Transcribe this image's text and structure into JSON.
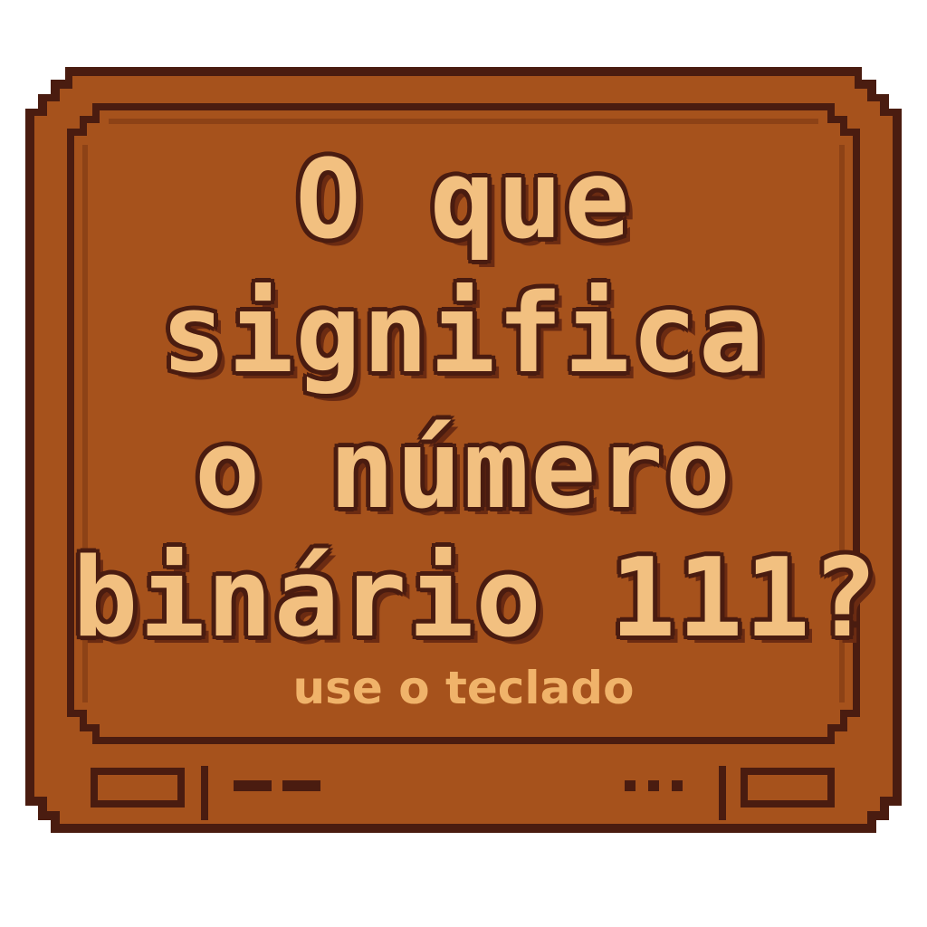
{
  "screen": {
    "question_lines": [
      "O que",
      "significa",
      "o número",
      "binário 111?"
    ],
    "hint": "use o teclado"
  },
  "colors": {
    "panel": "#a6521c",
    "outline": "#4a1c10",
    "text": "#f2c080",
    "hint": "#f0b36a"
  }
}
